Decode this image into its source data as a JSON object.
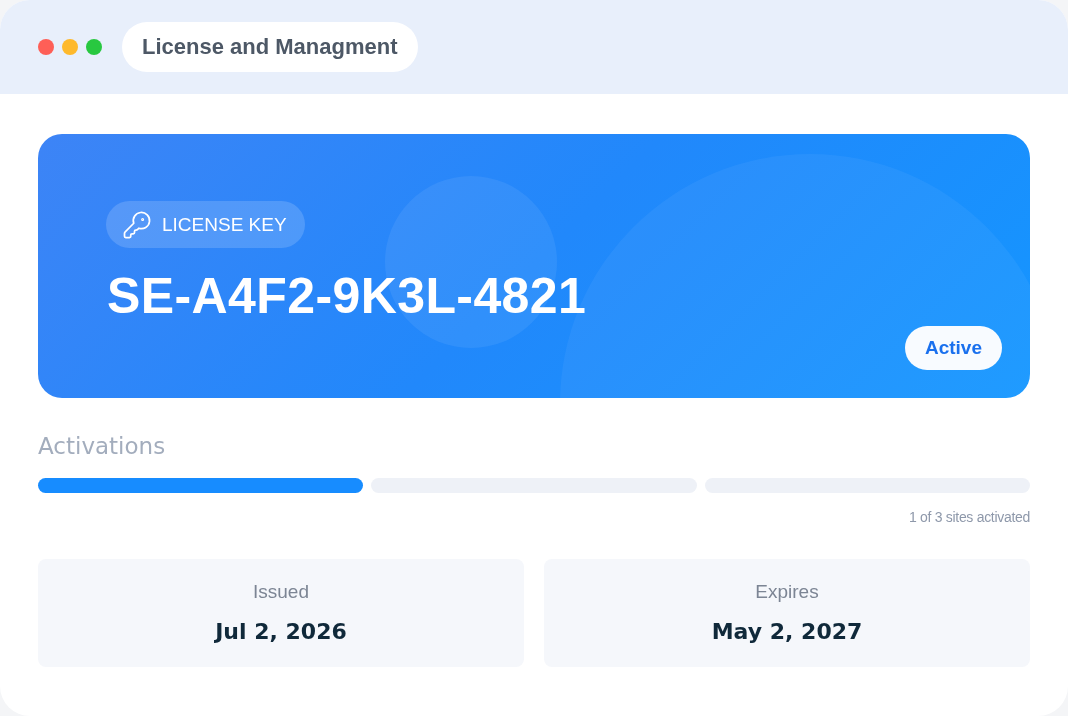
{
  "window": {
    "controls": [
      {
        "color": "#fe5f57"
      },
      {
        "color": "#feb92c"
      },
      {
        "color": "#28c840"
      }
    ],
    "title": "License and Managment"
  },
  "license": {
    "badge": "LICENSE KEY",
    "key": "SE-A4F2-9K3L-4821",
    "status": "Active"
  },
  "activations": {
    "title": "Activations",
    "segments": [
      {
        "filled": true
      },
      {
        "filled": false
      },
      {
        "filled": false
      }
    ],
    "summary": "1 of 3 sites activated"
  },
  "dates": [
    {
      "label": "Issued",
      "value": "Jul 2, 2026"
    },
    {
      "label": "Expires",
      "value": "May 2, 2027"
    }
  ]
}
